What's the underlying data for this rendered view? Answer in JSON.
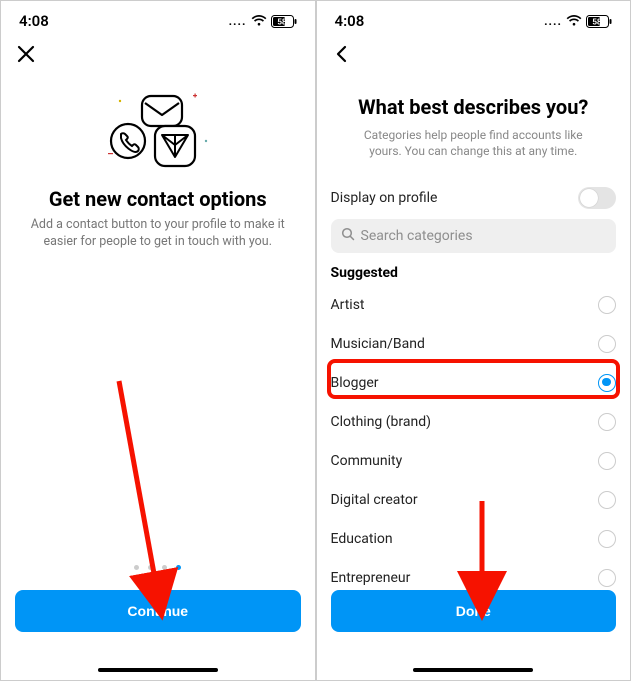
{
  "status": {
    "time": "4:08",
    "dots": "....",
    "battery": "58"
  },
  "left": {
    "title": "Get new contact options",
    "subtitle": "Add a contact button to your profile to make it easier for people to get in touch with you.",
    "cta": "Continue"
  },
  "right": {
    "title": "What best describes you?",
    "subtitle": "Categories help people find accounts like yours. You can change this at any time.",
    "display_label": "Display on profile",
    "search_placeholder": "Search categories",
    "suggested_heading": "Suggested",
    "categories": [
      {
        "label": "Artist",
        "selected": false
      },
      {
        "label": "Musician/Band",
        "selected": false
      },
      {
        "label": "Blogger",
        "selected": true
      },
      {
        "label": "Clothing (brand)",
        "selected": false
      },
      {
        "label": "Community",
        "selected": false
      },
      {
        "label": "Digital creator",
        "selected": false
      },
      {
        "label": "Education",
        "selected": false
      },
      {
        "label": "Entrepreneur",
        "selected": false
      }
    ],
    "cta": "Done"
  }
}
